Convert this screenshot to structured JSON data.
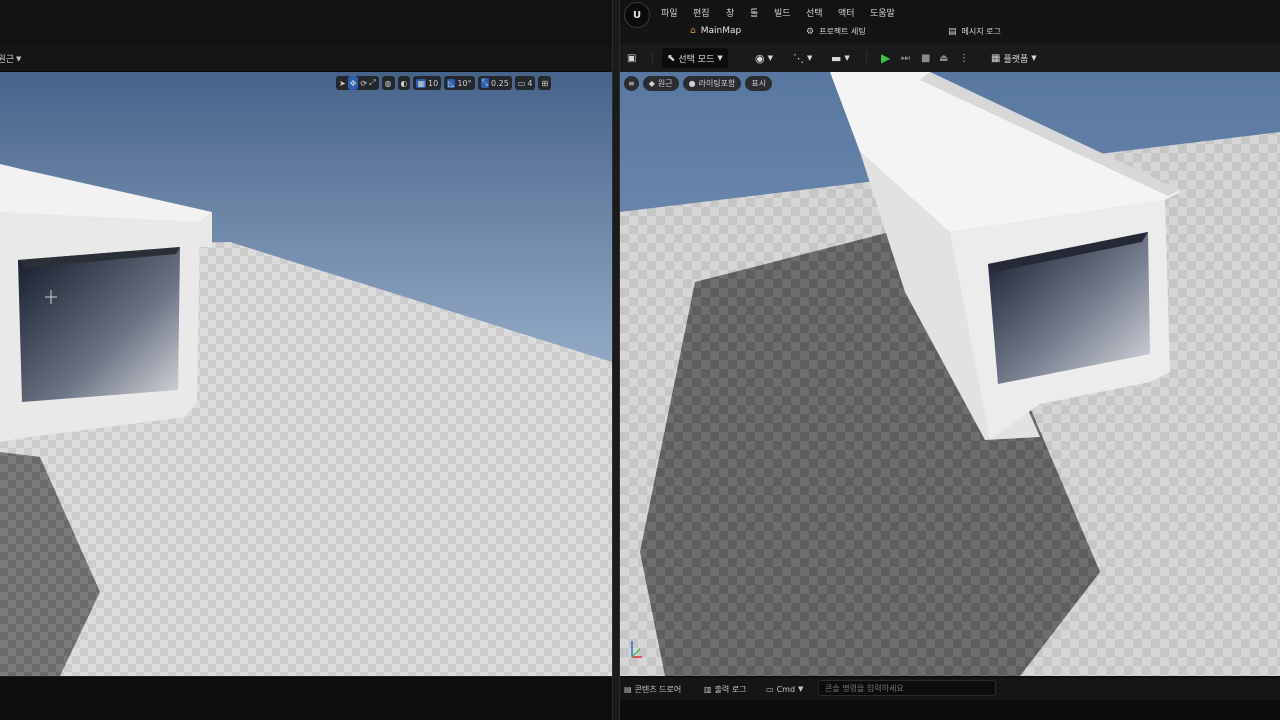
{
  "left_editor": {
    "header": {
      "mode_label": "원근"
    },
    "viewport_toolbar": {
      "grid_snap_value": "10",
      "rotation_snap_value": "10°",
      "scale_snap_value": "0.25",
      "camera_speed_value": "4"
    }
  },
  "right_editor": {
    "menu": [
      "파일",
      "편집",
      "창",
      "툴",
      "빌드",
      "선택",
      "액터",
      "도움말"
    ],
    "tabs": {
      "level_tab": "MainMap",
      "project_settings_tab": "프로젝트 세팅",
      "message_log_tab": "메시지 로그"
    },
    "toolbar": {
      "mode_label": "선택 모드",
      "platforms_label": "플랫폼"
    },
    "viewport_toolbar": {
      "perspective_label": "원근",
      "lit_label": "라이팅포함",
      "show_label": "표시"
    },
    "status_bar": {
      "content_drawer_label": "콘텐츠 드로어",
      "output_log_label": "출력 로그",
      "cmd_label": "Cmd",
      "cmd_placeholder": "콘솔 명령을 입력하세요"
    }
  },
  "colors": {
    "play_green": "#3fc23f",
    "axis_x": "#e03030",
    "axis_y": "#3fc23f",
    "axis_z": "#2f6fe0",
    "active_blue": "#2d5fb0"
  }
}
